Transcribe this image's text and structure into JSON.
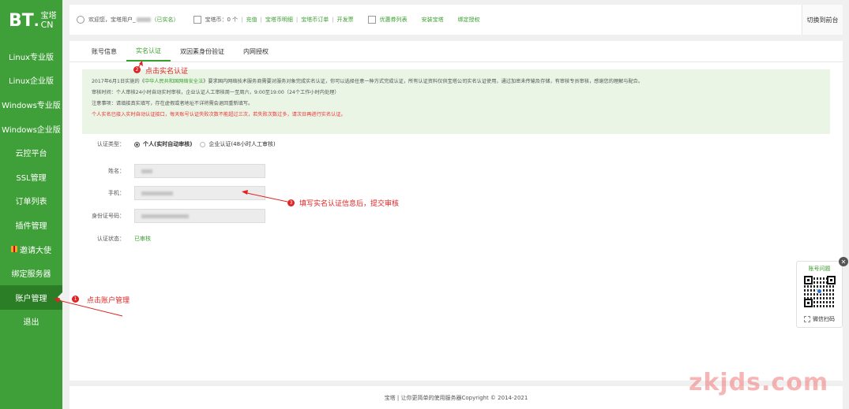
{
  "logo": {
    "bt": "BT",
    "dot": ".",
    "cn_top": "宝塔",
    "cn_bottom": "CN"
  },
  "sidebar": {
    "items": [
      {
        "label": "Linux专业版"
      },
      {
        "label": "Linux企业版"
      },
      {
        "label": "Windows专业版"
      },
      {
        "label": "Windows企业版"
      },
      {
        "label": "云控平台"
      },
      {
        "label": "SSL管理"
      },
      {
        "label": "订单列表"
      },
      {
        "label": "插件管理"
      },
      {
        "label": "邀请大使"
      },
      {
        "label": "绑定服务器"
      },
      {
        "label": "账户管理"
      },
      {
        "label": "退出"
      }
    ]
  },
  "topbar": {
    "welcome": "欢迎您，宝塔用户_",
    "verified": "（已实名）",
    "coins": "宝塔币：0 个",
    "recharge": "充值",
    "coin_detail": "宝塔币明细",
    "coin_orders": "宝塔币订单",
    "invoice": "开发票",
    "coupons": "优惠券列表",
    "install": "安装宝塔",
    "bind_auth": "绑定授权",
    "switch": "切换到前台"
  },
  "tabs": [
    "账号信息",
    "实名认证",
    "双因素身份验证",
    "内网授权"
  ],
  "notice": {
    "line1_pre": "2017年6月1日实施的《",
    "line1_law": "中华人民共和国网络安全法",
    "line1_post": "》要求国内网络技术服务商需要对服务对象完成实名认证，你可以选择任意一种方式完成认证，所有认证资料仅供宝塔公司实名认证使用，通过加密未传输及存储，有审核专员审核，感谢您的理解与配合。",
    "line2": "审核时间：个人审核24小时自动实时审核，企业认证人工审核周一至周六，9:00至19:00（24个工作小时内处理）",
    "line3": "注意事项：请填接真实填写，存在虚假或者地址不详将需会退回重新填写。",
    "line4": "个人实名已接入实时自动认证接口，每天账号认证失败次数不能超过三次，若失败次数过多，请次日再进行实名认证。"
  },
  "form": {
    "type_label": "认证类型：",
    "type_personal": "个人(实时自动审核)",
    "type_company": "企业认证(48小时人工审核)",
    "name_label": "姓名：",
    "phone_label": "手机：",
    "id_label": "身份证号码：",
    "status_label": "认证状态：",
    "status_value": "已审核"
  },
  "annotations": {
    "a1_num": "1",
    "a1_text": "点击账户管理",
    "a2_num": "2",
    "a2_text": "点击实名认证",
    "a3_num": "3",
    "a3_text": "填写实名认证信息后，提交审核"
  },
  "qr": {
    "title": "账号问题",
    "foot": "微信扫码",
    "close": "✕"
  },
  "footer": "宝塔 | 让你更简单的使用服务器Copyright © 2014-2021",
  "watermark": "zkjds.com",
  "colors": {
    "sidebar": "#3f9f38",
    "accent": "#3a9f2f",
    "annotation": "#e02424"
  }
}
